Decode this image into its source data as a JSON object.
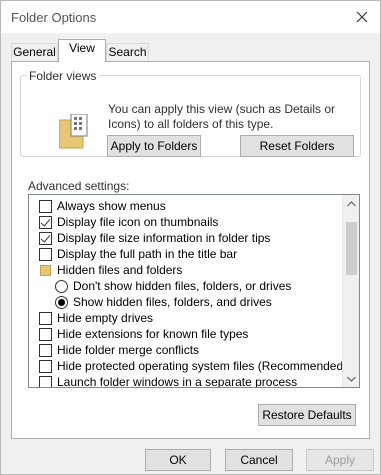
{
  "window": {
    "title": "Folder Options"
  },
  "tabs": [
    {
      "label": "General"
    },
    {
      "label": "View"
    },
    {
      "label": "Search"
    }
  ],
  "folder_views": {
    "legend": "Folder views",
    "description": "You can apply this view (such as Details or Icons) to all folders of this type.",
    "apply_button": "Apply to Folders",
    "reset_button": "Reset Folders"
  },
  "advanced": {
    "label": "Advanced settings:",
    "items": [
      {
        "type": "checkbox",
        "label": "Always show menus",
        "checked": false
      },
      {
        "type": "checkbox",
        "label": "Display file icon on thumbnails",
        "checked": true
      },
      {
        "type": "checkbox",
        "label": "Display file size information in folder tips",
        "checked": true
      },
      {
        "type": "checkbox",
        "label": "Display the full path in the title bar",
        "checked": false
      },
      {
        "type": "folder",
        "label": "Hidden files and folders"
      },
      {
        "type": "radio",
        "label": "Don't show hidden files, folders, or drives",
        "selected": false
      },
      {
        "type": "radio",
        "label": "Show hidden files, folders, and drives",
        "selected": true
      },
      {
        "type": "checkbox",
        "label": "Hide empty drives",
        "checked": false
      },
      {
        "type": "checkbox",
        "label": "Hide extensions for known file types",
        "checked": false
      },
      {
        "type": "checkbox",
        "label": "Hide folder merge conflicts",
        "checked": false
      },
      {
        "type": "checkbox",
        "label": "Hide protected operating system files (Recommended)",
        "checked": false
      },
      {
        "type": "checkbox",
        "label": "Launch folder windows in a separate process",
        "checked": false
      }
    ],
    "restore_button": "Restore Defaults"
  },
  "footer": {
    "ok": "OK",
    "cancel": "Cancel",
    "apply": "Apply"
  },
  "colors": {
    "accent_folder": "#e8c673",
    "disabled_text": "#9a9a9a"
  }
}
